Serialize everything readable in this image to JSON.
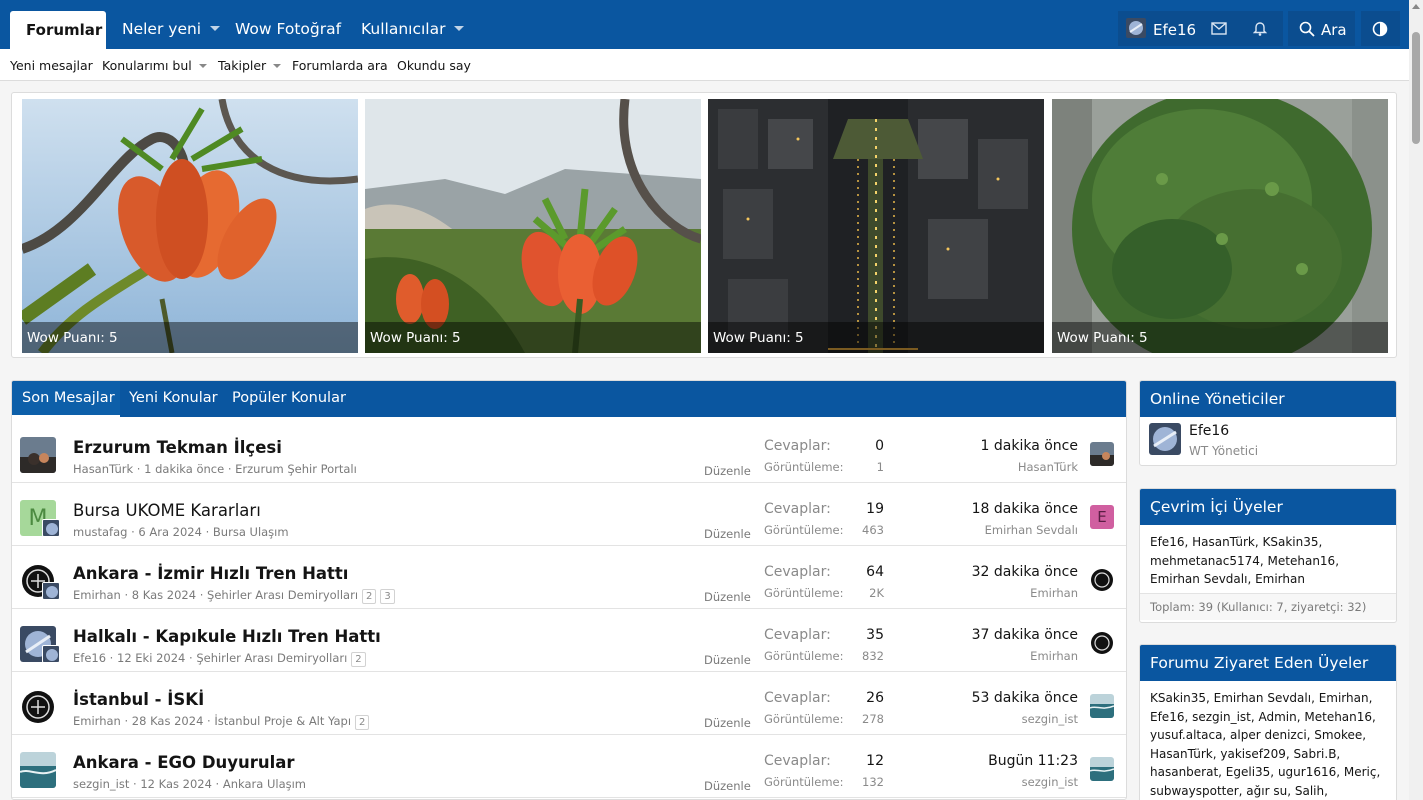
{
  "nav": {
    "active_tab": "Forumlar",
    "items": [
      {
        "label": "Neler yeni",
        "dropdown": true
      },
      {
        "label": "Wow Fotoğraf",
        "dropdown": false
      },
      {
        "label": "Kullanıcılar",
        "dropdown": true
      }
    ],
    "username": "Efe16",
    "search_label": "Ara",
    "icons": [
      "mail-icon",
      "bell-icon",
      "search-icon",
      "theme-toggle-icon"
    ]
  },
  "subnav": [
    {
      "label": "Yeni mesajlar",
      "dropdown": false
    },
    {
      "label": "Konularımı bul",
      "dropdown": true
    },
    {
      "label": "Takipler",
      "dropdown": true
    },
    {
      "label": "Forumlarda ara",
      "dropdown": false
    },
    {
      "label": "Okundu say",
      "dropdown": false
    }
  ],
  "gallery": [
    {
      "caption": "Wow Puanı: 5",
      "scene": "fritillaria-flower-sky"
    },
    {
      "caption": "Wow Puanı: 5",
      "scene": "fritillaria-flower-mountain"
    },
    {
      "caption": "Wow Puanı: 5",
      "scene": "city-night-aerial"
    },
    {
      "caption": "Wow Puanı: 5",
      "scene": "green-tree"
    }
  ],
  "tabs": [
    "Son Mesajlar",
    "Yeni Konular",
    "Popüler Konular"
  ],
  "labels": {
    "replies": "Cevaplar:",
    "views": "Görüntüleme:",
    "edit": "Düzenle"
  },
  "threads": [
    {
      "title": "Erzurum Tekman İlçesi",
      "bold": true,
      "author": "HasanTürk",
      "date": "1 dakika önce",
      "forum": "Erzurum Şehir Portalı",
      "pages": [],
      "replies": "0",
      "views": "1",
      "last_time": "1 dakika önce",
      "last_user": "HasanTürk"
    },
    {
      "title": "Bursa UKOME Kararları",
      "bold": false,
      "author": "mustafag",
      "date": "6 Ara 2024",
      "forum": "Bursa Ulaşım",
      "pages": [],
      "replies": "19",
      "views": "463",
      "last_time": "18 dakika önce",
      "last_user": "Emirhan Sevdalı",
      "avatar_letter": "M",
      "last_letter": "E"
    },
    {
      "title": "Ankara - İzmir Hızlı Tren Hattı",
      "bold": true,
      "author": "Emirhan",
      "date": "8 Kas 2024",
      "forum": "Şehirler Arası Demiryolları",
      "pages": [
        "2",
        "3"
      ],
      "replies": "64",
      "views": "2K",
      "last_time": "32 dakika önce",
      "last_user": "Emirhan"
    },
    {
      "title": "Halkalı - Kapıkule Hızlı Tren Hattı",
      "bold": true,
      "author": "Efe16",
      "date": "12 Eki 2024",
      "forum": "Şehirler Arası Demiryolları",
      "pages": [
        "2"
      ],
      "replies": "35",
      "views": "832",
      "last_time": "37 dakika önce",
      "last_user": "Emirhan"
    },
    {
      "title": "İstanbul - İSKİ",
      "bold": true,
      "author": "Emirhan",
      "date": "28 Kas 2024",
      "forum": "İstanbul Proje & Alt Yapı",
      "pages": [
        "2"
      ],
      "replies": "26",
      "views": "278",
      "last_time": "53 dakika önce",
      "last_user": "sezgin_ist"
    },
    {
      "title": "Ankara - EGO Duyurular",
      "bold": true,
      "author": "sezgin_ist",
      "date": "12 Kas 2024",
      "forum": "Ankara Ulaşım",
      "pages": [],
      "replies": "12",
      "views": "132",
      "last_time": "Bugün 11:23",
      "last_user": "sezgin_ist"
    }
  ],
  "sidebar": {
    "staff": {
      "title": "Online Yöneticiler",
      "name": "Efe16",
      "role": "WT Yönetici"
    },
    "online": {
      "title": "Çevrim İçi Üyeler",
      "members": "Efe16, HasanTürk, KSakin35, mehmetanac5174, Metehan16, Emirhan Sevdalı, Emirhan",
      "total": "Toplam: 39 (Kullanıcı: 7, ziyaretçi: 32)"
    },
    "visitors": {
      "title": "Forumu Ziyaret Eden Üyeler",
      "members": "KSakin35, Emirhan Sevdalı, Emirhan, Efe16, sezgin_ist, Admin, Metehan16, yusuf.altaca, alper denizci, Smokee, HasanTürk, yakisef209, Sabri.B, hasanberat, Egeli35, ugur1616, Meriç, subwayspotter, ağır su, Salih,"
    }
  }
}
